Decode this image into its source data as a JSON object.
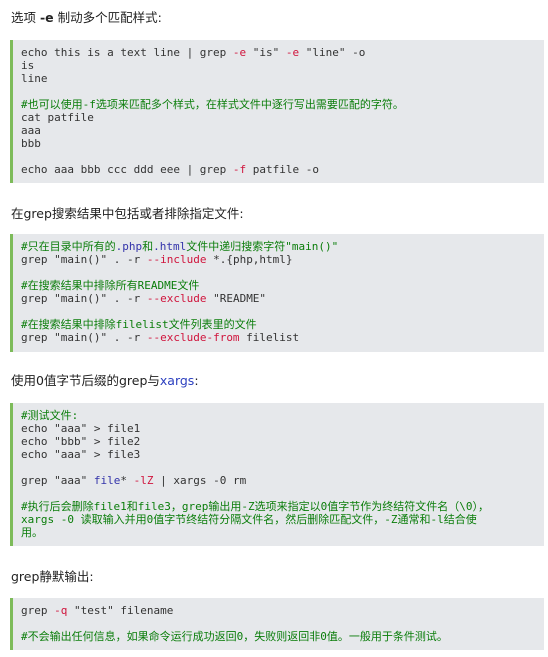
{
  "sections": [
    {
      "heading": [
        {
          "t": "选项 "
        },
        {
          "t": "-e",
          "c": "kw"
        },
        {
          "t": " 制动多个匹配样式:"
        }
      ],
      "code": [
        [
          {
            "t": "echo this is a text line | grep "
          },
          {
            "t": "-e",
            "c": "flag"
          },
          {
            "t": " \"is\" "
          },
          {
            "t": "-e",
            "c": "flag"
          },
          {
            "t": " \"line\" -o"
          }
        ],
        [
          {
            "t": "is"
          }
        ],
        [
          {
            "t": "line"
          }
        ],
        [],
        [
          {
            "t": "#也可以使用-f选项来匹配多个样式，在样式文件中逐行写出需要匹配的字符。",
            "c": "comment"
          }
        ],
        [
          {
            "t": "cat patfile"
          }
        ],
        [
          {
            "t": "aaa"
          }
        ],
        [
          {
            "t": "bbb"
          }
        ],
        [],
        [
          {
            "t": "echo aaa bbb ccc ddd eee | grep "
          },
          {
            "t": "-f",
            "c": "flag"
          },
          {
            "t": " patfile -o"
          }
        ]
      ]
    },
    {
      "heading": [
        {
          "t": "在grep搜索结果中包括或者排除指定文件:"
        }
      ],
      "code": [
        [
          {
            "t": "#只在目录中所有的",
            "c": "comment"
          },
          {
            "t": ".php",
            "c": "var"
          },
          {
            "t": "和",
            "c": "comment"
          },
          {
            "t": ".html",
            "c": "var"
          },
          {
            "t": "文件中递归搜索字符\"main()\"",
            "c": "comment"
          }
        ],
        [
          {
            "t": "grep \"main()\" . -r "
          },
          {
            "t": "--include",
            "c": "flag"
          },
          {
            "t": " *.{php,html}"
          }
        ],
        [],
        [
          {
            "t": "#在搜索结果中排除所有README文件",
            "c": "comment"
          }
        ],
        [
          {
            "t": "grep \"main()\" . -r "
          },
          {
            "t": "--exclude",
            "c": "flag"
          },
          {
            "t": " \"README\""
          }
        ],
        [],
        [
          {
            "t": "#在搜索结果中排除filelist文件列表里的文件",
            "c": "comment"
          }
        ],
        [
          {
            "t": "grep \"main()\" . -r "
          },
          {
            "t": "--exclude-from",
            "c": "flag"
          },
          {
            "t": " filelist"
          }
        ]
      ]
    },
    {
      "heading": [
        {
          "t": "使用0值字节后缀的grep与"
        },
        {
          "t": "xargs",
          "c": "link"
        },
        {
          "t": ":"
        }
      ],
      "code": [
        [
          {
            "t": "#测试文件:",
            "c": "comment"
          }
        ],
        [
          {
            "t": "echo \"aaa\" > file1"
          }
        ],
        [
          {
            "t": "echo \"bbb\" > file2"
          }
        ],
        [
          {
            "t": "echo \"aaa\" > file3"
          }
        ],
        [],
        [
          {
            "t": "grep \"aaa\" "
          },
          {
            "t": "file",
            "c": "var"
          },
          {
            "t": "* "
          },
          {
            "t": "-lZ",
            "c": "flag"
          },
          {
            "t": " | xargs -0 rm"
          }
        ],
        [],
        [
          {
            "t": "#执行后会删除file1和file3，grep输出用-Z选项来指定以0值字节作为终结符文件名（\\0），",
            "c": "comment"
          }
        ],
        [
          {
            "t": "xargs -0 读取输入并用0值字节终结符分隔文件名，然后删除匹配文件，-Z通常和-l结合使",
            "c": "comment"
          }
        ],
        [
          {
            "t": "用。",
            "c": "comment"
          }
        ]
      ]
    },
    {
      "heading": [
        {
          "t": "grep静默输出:"
        }
      ],
      "code": [
        [
          {
            "t": "grep "
          },
          {
            "t": "-q",
            "c": "flag"
          },
          {
            "t": " \"test\" filename"
          }
        ],
        [],
        [
          {
            "t": "#不会输出任何信息，如果命令运行成功返回0，失败则返回非0值。一般用于条件测试。",
            "c": "comment"
          }
        ]
      ]
    }
  ],
  "colors": {
    "comment": "#0a7d0a",
    "flag": "#d0143c",
    "var": "#3333aa",
    "border": "#7dbb5a",
    "code_bg": "#e6e8eb"
  }
}
